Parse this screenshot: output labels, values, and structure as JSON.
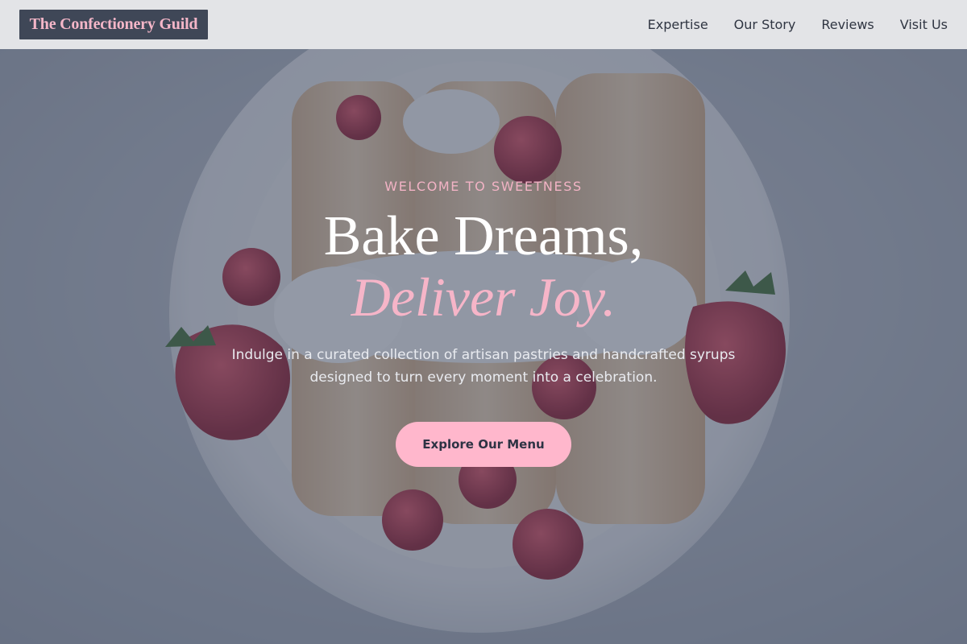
{
  "header": {
    "brand": "The Confectionery Guild",
    "nav": [
      {
        "label": "Expertise"
      },
      {
        "label": "Our Story"
      },
      {
        "label": "Reviews"
      },
      {
        "label": "Visit Us"
      }
    ]
  },
  "hero": {
    "eyebrow": "WELCOME TO SWEETNESS",
    "headline_line1": "Bake Dreams,",
    "headline_line2": "Deliver Joy.",
    "description": "Indulge in a curated collection of artisan pastries and handcrafted syrups designed to turn every moment into a celebration.",
    "cta_label": "Explore Our Menu"
  },
  "colors": {
    "accent_pink": "#ffb7cc",
    "header_bg": "#e3e4e7",
    "brand_bg": "#3f4757"
  }
}
